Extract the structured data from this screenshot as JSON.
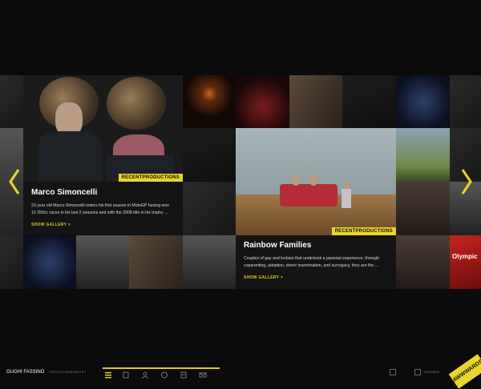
{
  "features": {
    "marco": {
      "title": "Marco Simoncelli",
      "badge": "RECENTPRODUCTIONS",
      "description": "23 year old Marco Simoncelli enters his first season in MotoGP having won 12 250cc races in his last 2 seasons and with the 2008 title in his trophy ...",
      "link": "SHOW GALLERY >"
    },
    "rainbow": {
      "title": "Rainbow Families",
      "badge": "RECENTPRODUCTIONS",
      "description": "Couples of gay and lesbian that undertook a parental experience, through coparenting, adoption, donor insemination, and surrogacy, they are the ...",
      "link": "SHOW GALLERY >"
    }
  },
  "tiles": {
    "olympic_text": "Olympic"
  },
  "nav": {
    "prev_icon": "chevron-left-icon",
    "next_icon": "chevron-right-icon",
    "accent": "#e8d62a"
  },
  "bottom": {
    "brand": "GUGHI FASSINO",
    "brand_sub": "PHOTOJOURNALIST",
    "tool_label": "TOOLBOX",
    "awards_text": "AWWWARDS"
  }
}
